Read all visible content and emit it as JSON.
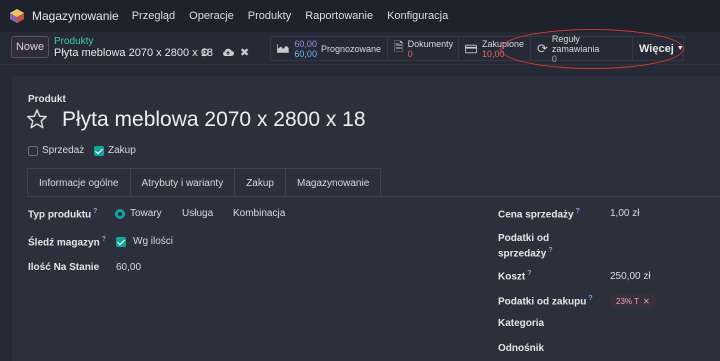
{
  "navbar": {
    "app_name": "Magazynowanie",
    "menu": [
      "Przegląd",
      "Operacje",
      "Produkty",
      "Raportowanie",
      "Konfiguracja"
    ]
  },
  "control": {
    "new_label": "Nowe",
    "breadcrumb_parent": "Produkty",
    "breadcrumb_current": "Płyta meblowa 2070 x 2800 x 18",
    "smart_buttons": {
      "forecast": {
        "value_a": "60,00",
        "value_b": "60,00",
        "label": "Prognozowane"
      },
      "documents": {
        "label": "Dokumenty",
        "count": "0"
      },
      "purchased": {
        "label": "Zakupione",
        "count": "10,00"
      },
      "reorder": {
        "label": "Reguły zamawiania",
        "count": "0"
      },
      "more": "Więcej"
    }
  },
  "form": {
    "section_label": "Produkt",
    "title": "Płyta meblowa 2070 x 2800 x 18",
    "checkboxes": {
      "sale": "Sprzedaż",
      "purchase": "Zakup"
    },
    "tabs": [
      "Informacje ogólne",
      "Atrybuty i warianty",
      "Zakup",
      "Magazynowanie"
    ],
    "left": {
      "product_type_label": "Typ produktu",
      "product_type_options": [
        "Towary",
        "Usługa",
        "Kombinacja"
      ],
      "track_label": "Śledź magazyn",
      "track_value": "Wg ilości",
      "qty_label": "Ilość Na Stanie",
      "qty_value": "60,00"
    },
    "right": {
      "sale_price_label": "Cena sprzedaży",
      "sale_price_value": "1,00 zł",
      "sale_tax_label_1": "Podatki od",
      "sale_tax_label_2": "sprzedaży",
      "cost_label": "Koszt",
      "cost_value": "250,00 zł",
      "purchase_tax_label": "Podatki od zakupu",
      "purchase_tax_value": "23% T",
      "category_label": "Kategoria",
      "reference_label": "Odnośnik"
    },
    "help_mark": "?"
  },
  "colors": {
    "accent_teal": "#14a59a",
    "annotation_red": "#d23a2c",
    "background": "#262a36"
  }
}
